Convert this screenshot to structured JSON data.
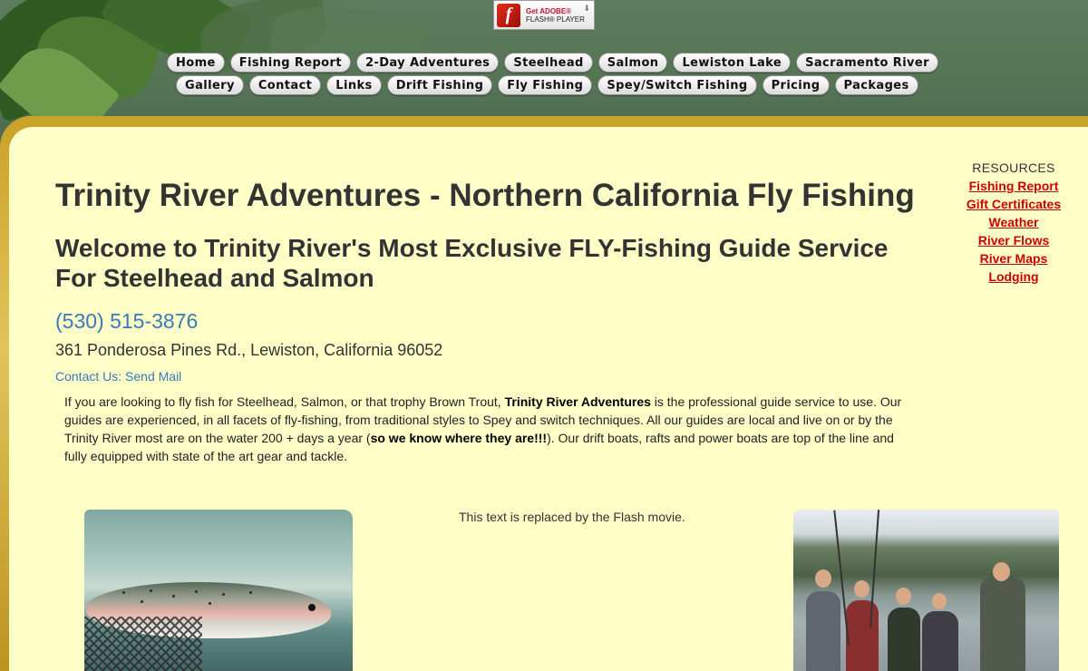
{
  "flash_badge": {
    "line1": "Get ADOBE®",
    "line2": "FLASH® PLAYER",
    "logo": "f"
  },
  "nav": {
    "row1": [
      "Home",
      "Fishing Report",
      "2-Day Adventures",
      "Steelhead",
      "Salmon",
      "Lewiston Lake",
      "Sacramento River"
    ],
    "row2": [
      "Gallery",
      "Contact",
      "Links",
      "Drift Fishing",
      "Fly Fishing",
      "Spey/Switch Fishing",
      "Pricing",
      "Packages"
    ]
  },
  "resources": {
    "title": "RESOURCES",
    "links": [
      "Fishing Report",
      "Gift Certificates",
      "Weather",
      "River Flows",
      "River Maps",
      "Lodging"
    ]
  },
  "main": {
    "title": "Trinity River Adventures - Northern California Fly Fishing",
    "subtitle": "Welcome to Trinity River's Most Exclusive FLY-Fishing Guide Service For Steelhead and Salmon",
    "phone": "(530) 515-3876",
    "address": "361 Ponderosa Pines Rd., Lewiston, California 96052",
    "contact_label": "Contact Us:",
    "contact_link": "Send Mail",
    "intro_part1": "If you are looking to fly fish for Steelhead, Salmon, or that trophy Brown Trout,",
    "intro_bold1": "Trinity River Adventures",
    "intro_part2": "is the professional guide service to use. Our guides are experienced, in all facets of fly-fishing, from traditional styles to Spey and switch techniques. All our guides are local and live on or by the Trinity River most are on the water 200 + days a year (",
    "intro_bold2": "so we know where they are!!!",
    "intro_part3": "). Our drift boats, rafts and power boats are top of the line and fully equipped with state of the art gear and tackle.",
    "flash_note": "This text is replaced by the Flash movie."
  }
}
